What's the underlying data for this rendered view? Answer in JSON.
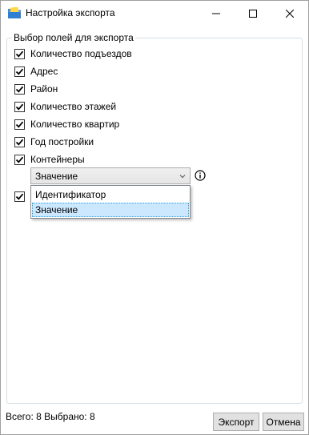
{
  "window": {
    "title": "Настройка экспорта"
  },
  "group": {
    "legend": "Выбор полей для экспорта"
  },
  "fields": [
    {
      "label": "Количество подъездов",
      "checked": true
    },
    {
      "label": "Адрес",
      "checked": true
    },
    {
      "label": "Район",
      "checked": true
    },
    {
      "label": "Количество этажей",
      "checked": true
    },
    {
      "label": "Количество квартир",
      "checked": true
    },
    {
      "label": "Год постройки",
      "checked": true
    },
    {
      "label": "Контейнеры",
      "checked": true
    },
    {
      "label": "",
      "checked": true
    }
  ],
  "containers_mode": {
    "selected": "Значение",
    "options": [
      "Идентификатор",
      "Значение"
    ],
    "highlighted_index": 1
  },
  "footer": {
    "status": "Всего: 8 Выбрано: 8",
    "export_label": "Экспорт",
    "cancel_label": "Отмена"
  },
  "icons": {
    "app": "app-folder-icon",
    "info": "info-icon",
    "checkmark": "checkmark-icon",
    "dropdown_arrow": "chevron-down-icon"
  },
  "colors": {
    "selection_bg": "#cce8ff",
    "selection_border": "#26a0da",
    "button_bg": "#e1e1e1",
    "group_border": "#d5dfe5"
  }
}
